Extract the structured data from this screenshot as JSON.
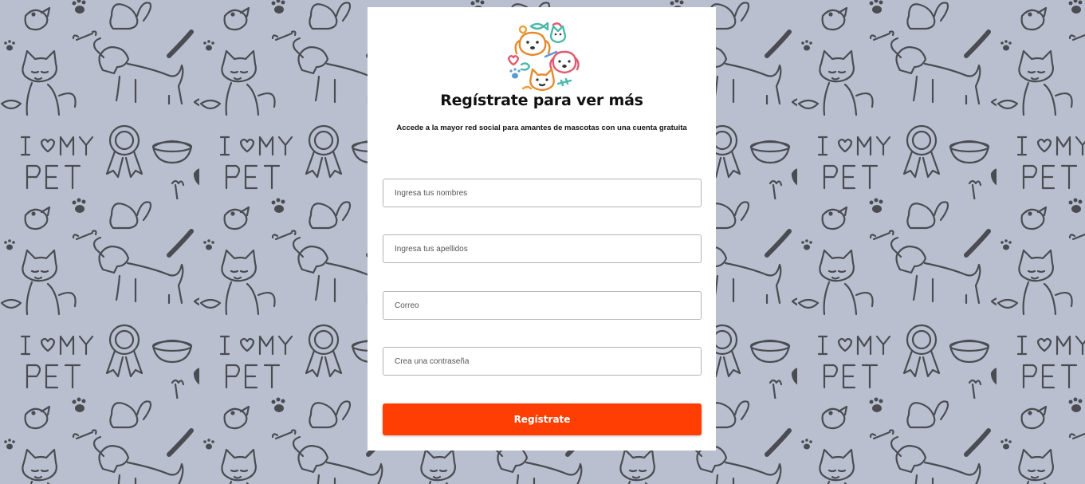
{
  "background": {
    "color": "#b9bfcf",
    "line_color": "#4a4c52",
    "pattern_text_top": "I ♥ MY",
    "pattern_text_bottom": "PET"
  },
  "card": {
    "logo_icon": "pets-circle-logo-icon",
    "title": "Regístrate para ver más",
    "subtitle": "Accede a la mayor red social para amantes de mascotas con una cuenta gratuita"
  },
  "form": {
    "first_names_placeholder": "Ingresa tus nombres",
    "last_names_placeholder": "Ingresa tus apellidos",
    "email_placeholder": "Correo",
    "password_placeholder": "Crea una contraseña",
    "submit_label": "Regístrate",
    "submit_color": "#fe3e03"
  }
}
